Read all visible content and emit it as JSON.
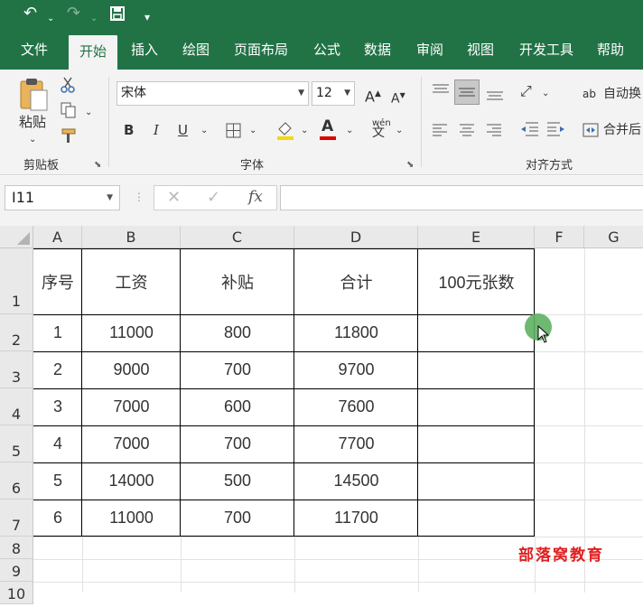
{
  "qat": {
    "undo_icon": "↶",
    "redo_icon": "↷",
    "save_icon": "save-icon",
    "customize_icon": "▾"
  },
  "tabs": [
    "文件",
    "开始",
    "插入",
    "绘图",
    "页面布局",
    "公式",
    "数据",
    "审阅",
    "视图",
    "开发工具",
    "帮助"
  ],
  "active_tab": "开始",
  "ribbon": {
    "clipboard": {
      "paste_label": "粘贴",
      "group_label": "剪贴板"
    },
    "font": {
      "font_name": "宋体",
      "font_size": "12",
      "group_label": "字体",
      "bold": "B",
      "italic": "I",
      "underline": "U",
      "grow": "A",
      "shrink": "A",
      "font_color_label": "A",
      "phonetic": "wén"
    },
    "alignment": {
      "wrap_text": "自动换",
      "merge": "合并后",
      "group_label": "对齐方式"
    }
  },
  "formula_bar": {
    "name_box": "I11",
    "fx": "fx",
    "cancel": "✕",
    "enter": "✓",
    "value": ""
  },
  "columns": [
    "A",
    "B",
    "C",
    "D",
    "E",
    "F",
    "G"
  ],
  "rows": [
    "1",
    "2",
    "3",
    "4",
    "5",
    "6",
    "7",
    "8",
    "9",
    "10"
  ],
  "table": {
    "headers": [
      "序号",
      "工资",
      "补贴",
      "合计",
      "100元张数"
    ],
    "data": [
      [
        "1",
        "11000",
        "800",
        "11800",
        ""
      ],
      [
        "2",
        "9000",
        "700",
        "9700",
        ""
      ],
      [
        "3",
        "7000",
        "600",
        "7600",
        ""
      ],
      [
        "4",
        "7000",
        "700",
        "7700",
        ""
      ],
      [
        "5",
        "14000",
        "500",
        "14500",
        ""
      ],
      [
        "6",
        "11000",
        "700",
        "11700",
        ""
      ]
    ]
  },
  "watermark": "部落窝教育",
  "colors": {
    "brand": "#217346",
    "watermark": "#e02020",
    "cursor_highlight": "#5fb063"
  }
}
